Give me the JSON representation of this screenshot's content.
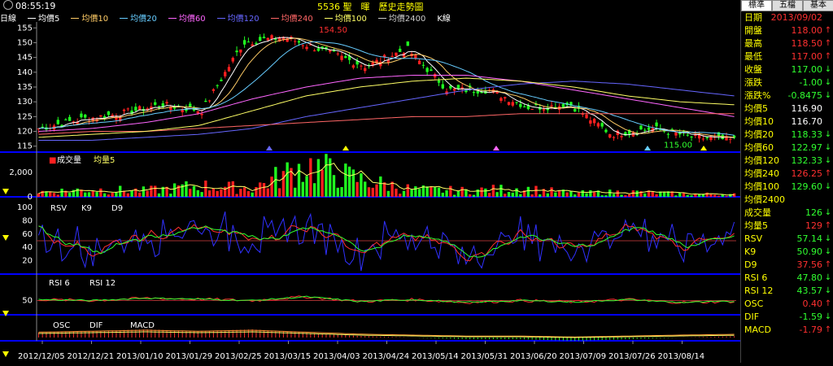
{
  "header": {
    "time": "08:55:19",
    "title": "5536 聖　暉　歷史走勢圖"
  },
  "legend": [
    {
      "label": "日線",
      "color": "#ffffff",
      "swatch": false
    },
    {
      "label": "均價5",
      "color": "#ffffff",
      "swatch": true
    },
    {
      "label": "均價10",
      "color": "#ffcc66",
      "swatch": true
    },
    {
      "label": "均價20",
      "color": "#66ccff",
      "swatch": true
    },
    {
      "label": "均價60",
      "color": "#ff66ff",
      "swatch": true
    },
    {
      "label": "均價120",
      "color": "#6666ff",
      "swatch": true
    },
    {
      "label": "均價240",
      "color": "#ff6666",
      "swatch": true
    },
    {
      "label": "均價100",
      "color": "#ffff66",
      "swatch": true
    },
    {
      "label": "均價2400",
      "color": "#cccccc",
      "swatch": true
    },
    {
      "label": "K線",
      "color": "#ffffff",
      "swatch": false
    }
  ],
  "sidebar": {
    "tabs": [
      "標準",
      "五檔",
      "基本"
    ],
    "rows": [
      {
        "label": "日期",
        "value": "2013/09/02",
        "color": "#ff3030",
        "arrow": ""
      },
      {
        "label": "開盤",
        "value": "118.00",
        "color": "#ff3030",
        "arrow": "↑"
      },
      {
        "label": "最高",
        "value": "118.50",
        "color": "#ff3030",
        "arrow": "↑"
      },
      {
        "label": "最低",
        "value": "117.00",
        "color": "#ff3030",
        "arrow": "↑"
      },
      {
        "label": "收盤",
        "value": "117.00",
        "color": "#30ff30",
        "arrow": "↓"
      },
      {
        "label": "漲跌",
        "value": "-1.00",
        "color": "#30ff30",
        "arrow": "↓"
      },
      {
        "label": "漲跌%",
        "value": "-0.8475",
        "color": "#30ff30",
        "arrow": "↓"
      },
      {
        "label": "均價5",
        "value": "116.90",
        "color": "#ffffff",
        "arrow": ""
      },
      {
        "label": "均價10",
        "value": "116.70",
        "color": "#ffffff",
        "arrow": ""
      },
      {
        "label": "均價20",
        "value": "118.33",
        "color": "#30ff30",
        "arrow": "↓"
      },
      {
        "label": "均價60",
        "value": "122.97",
        "color": "#30ff30",
        "arrow": "↓"
      },
      {
        "label": "均價120",
        "value": "132.33",
        "color": "#30ff30",
        "arrow": "↓"
      },
      {
        "label": "均價240",
        "value": "126.25",
        "color": "#ff3030",
        "arrow": "↑"
      },
      {
        "label": "均價100",
        "value": "129.60",
        "color": "#30ff30",
        "arrow": "↓"
      },
      {
        "label": "均價2400",
        "value": "",
        "color": "#ffffff",
        "arrow": ""
      },
      {
        "label": "成交量",
        "value": "126",
        "color": "#30ff30",
        "arrow": "↓"
      },
      {
        "label": "均量5",
        "value": "129",
        "color": "#ff3030",
        "arrow": "↑"
      },
      {
        "label": "RSV",
        "value": "57.14",
        "color": "#30ff30",
        "arrow": "↓"
      },
      {
        "label": "K9",
        "value": "50.90",
        "color": "#30ff30",
        "arrow": "↓"
      },
      {
        "label": "D9",
        "value": "37.56",
        "color": "#ff3030",
        "arrow": "↑"
      },
      {
        "label": "RSI 6",
        "value": "47.80",
        "color": "#30ff30",
        "arrow": "↓"
      },
      {
        "label": "RSI 12",
        "value": "43.57",
        "color": "#30ff30",
        "arrow": "↓"
      },
      {
        "label": "OSC",
        "value": "0.40",
        "color": "#ff3030",
        "arrow": "↑"
      },
      {
        "label": "DIF",
        "value": "-1.59",
        "color": "#30ff30",
        "arrow": "↓"
      },
      {
        "label": "MACD",
        "value": "-1.79",
        "color": "#ff3030",
        "arrow": "↑"
      }
    ]
  },
  "panels": {
    "volume_legend": [
      "成交量",
      "均量5"
    ],
    "kd_legend": [
      "RSV",
      "K9",
      "D9"
    ],
    "rsi_legend": [
      "RSI 6",
      "RSI 12"
    ],
    "macd_legend": [
      "OSC",
      "DIF",
      "MACD"
    ]
  },
  "chart_data": {
    "type": "line",
    "price_axis": {
      "ticks": [
        115,
        120,
        125,
        130,
        135,
        140,
        145,
        150,
        155
      ],
      "ylim": [
        113,
        157
      ]
    },
    "volume_axis": {
      "ticks": [
        0,
        2000
      ],
      "ylim": [
        0,
        3000
      ]
    },
    "kd_axis": {
      "ticks": [
        20,
        40,
        60,
        80,
        100
      ],
      "ylim": [
        0,
        100
      ]
    },
    "rsi_axis": {
      "ticks": [
        50
      ],
      "ylim": [
        20,
        80
      ]
    },
    "annotations": {
      "high": "154.50",
      "low": "115.00"
    },
    "x_dates": [
      "2012/12/05",
      "2012/12/21",
      "2013/01/10",
      "2013/01/29",
      "2013/02/25",
      "2013/03/15",
      "2013/04/03",
      "2013/04/24",
      "2013/05/14",
      "2013/05/31",
      "2013/06/20",
      "2013/07/09",
      "2013/07/26",
      "2013/08/14"
    ],
    "close_anchors": [
      121,
      124,
      126,
      129,
      127,
      150,
      152,
      147,
      142,
      148,
      134,
      134,
      128,
      129,
      119,
      121,
      118,
      117
    ],
    "ma60_anchors": [
      120,
      121,
      123,
      126,
      131,
      135,
      138,
      139,
      139,
      137,
      134,
      131,
      128,
      125
    ],
    "ma120_anchors": [
      117,
      117,
      118,
      119,
      121,
      125,
      128,
      131,
      134,
      136,
      137,
      136,
      134,
      132
    ],
    "ma240_anchors": [
      119,
      120,
      120,
      121,
      122,
      123,
      124,
      125,
      125,
      126,
      126,
      126,
      126,
      126
    ],
    "ma100_anchors": [
      118,
      119,
      120,
      122,
      127,
      132,
      135,
      137,
      138,
      137,
      135,
      132,
      130,
      129
    ],
    "volume_anchors": [
      400,
      600,
      500,
      900,
      700,
      2600,
      1400,
      600,
      500,
      700,
      300,
      400,
      250,
      200
    ],
    "kd_k_anchors": [
      60,
      35,
      55,
      70,
      50,
      75,
      40,
      55,
      30,
      60,
      35,
      70,
      45,
      50
    ],
    "kd_d_anchors": [
      55,
      40,
      50,
      62,
      55,
      68,
      48,
      52,
      38,
      55,
      40,
      60,
      45,
      37
    ],
    "rsi_anchors": [
      52,
      50,
      55,
      53,
      50,
      58,
      48,
      52,
      46,
      50,
      47,
      52,
      46,
      48
    ],
    "osc_anchors": [
      1.5,
      2,
      2.5,
      2,
      2.5,
      1.5,
      0.5,
      0,
      -0.5,
      -0.5,
      -1,
      -0.5,
      0,
      0.4
    ]
  }
}
